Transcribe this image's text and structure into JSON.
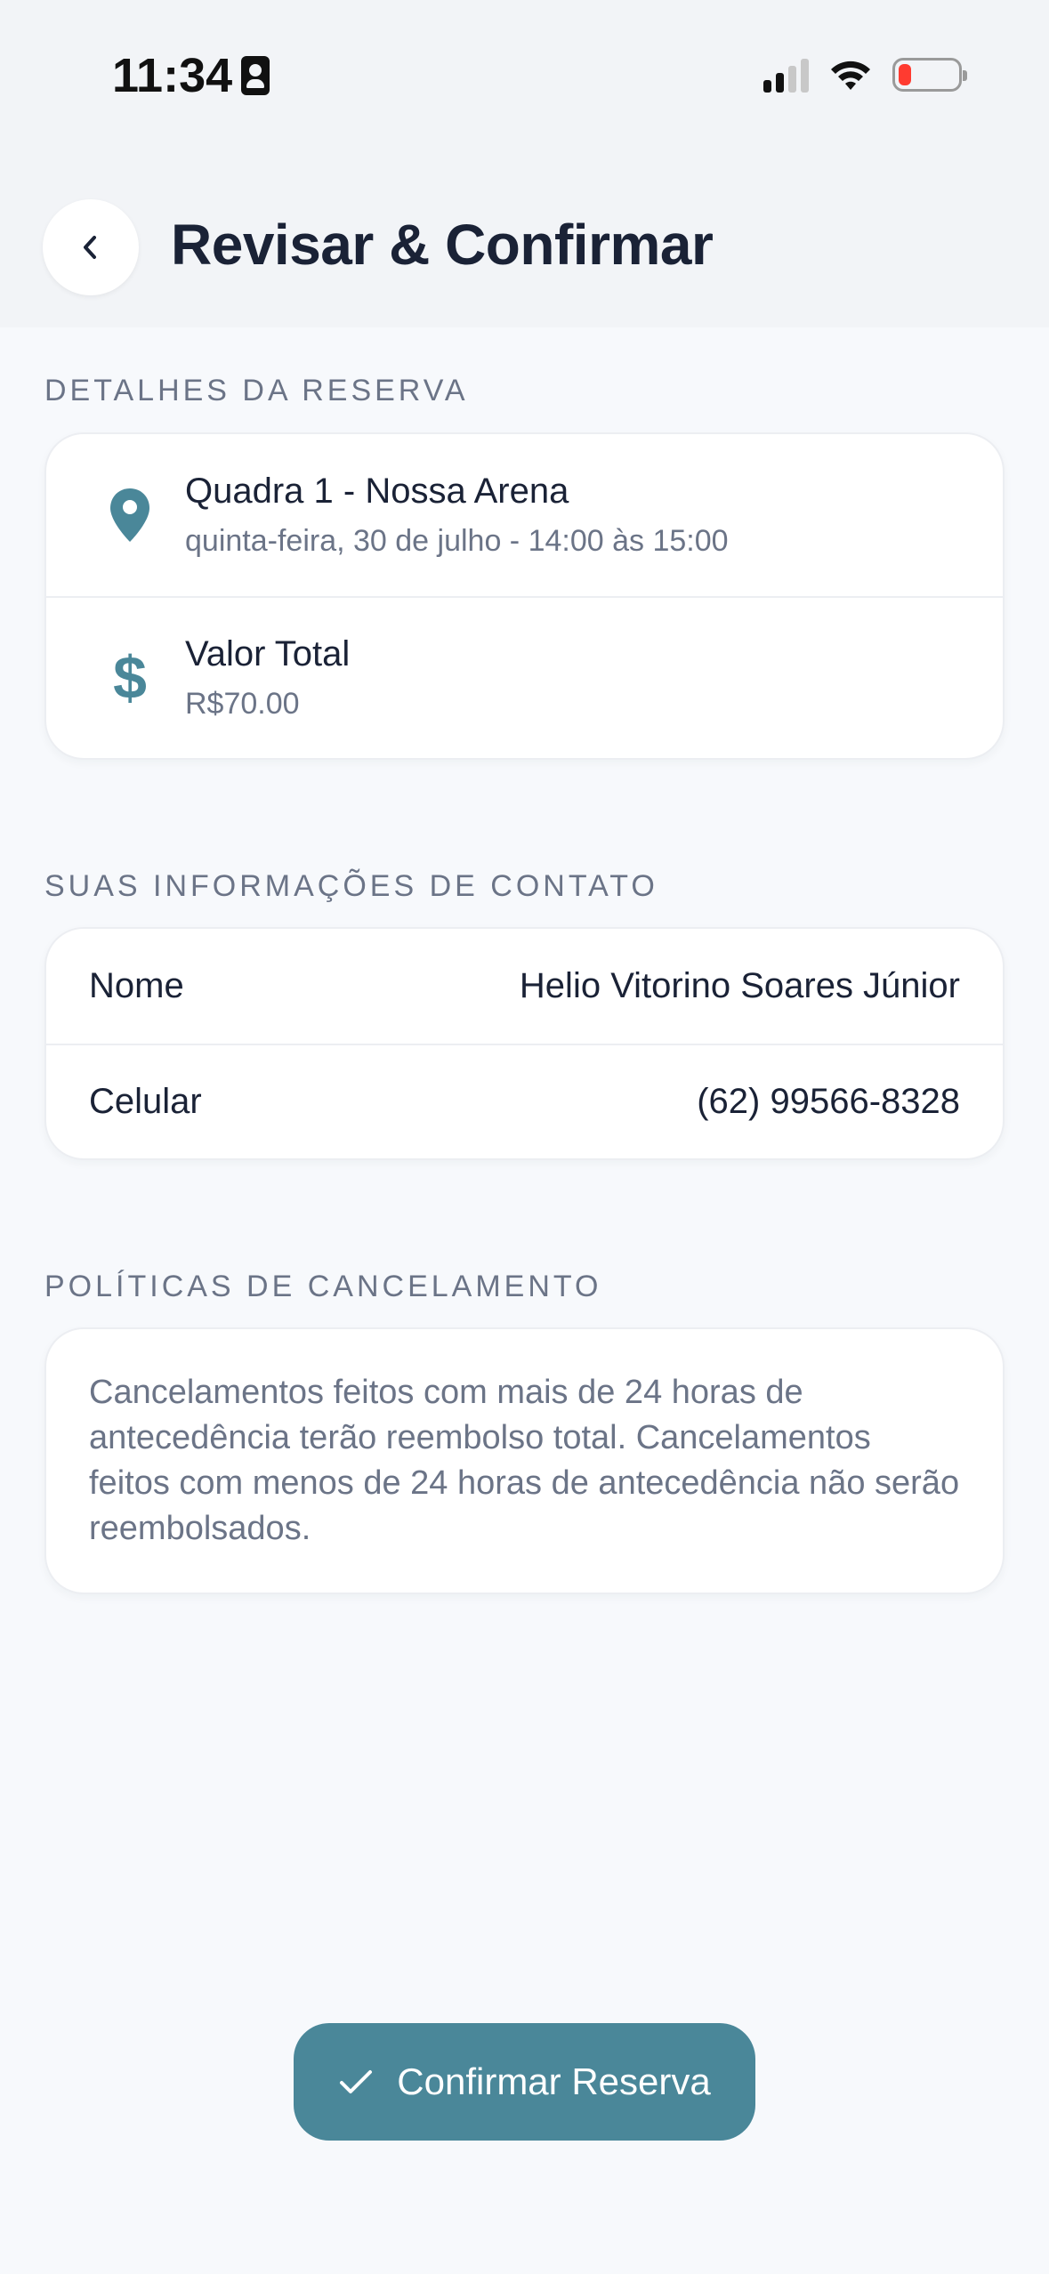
{
  "status_bar": {
    "time": "11:34"
  },
  "header": {
    "title": "Revisar & Confirmar"
  },
  "booking": {
    "section_label": "DETALHES DA RESERVA",
    "location_title": "Quadra 1 - Nossa Arena",
    "location_subtitle": "quinta-feira, 30 de julho - 14:00 às 15:00",
    "price_title": "Valor Total",
    "price_value": "R$70.00"
  },
  "contact": {
    "section_label": "SUAS INFORMAÇÕES DE CONTATO",
    "rows": [
      {
        "label": "Nome",
        "value": "Helio Vitorino Soares Júnior"
      },
      {
        "label": "Celular",
        "value": "(62) 99566-8328"
      }
    ]
  },
  "policy": {
    "section_label": "POLÍTICAS DE CANCELAMENTO",
    "text": "Cancelamentos feitos com mais de 24 horas de antecedência terão reembolso total. Cancelamentos feitos com menos de 24 horas de antecedência não serão reembolsados."
  },
  "footer": {
    "confirm_label": "Confirmar Reserva"
  },
  "colors": {
    "accent": "#4a8799",
    "text": "#1a2236",
    "muted": "#6b7487",
    "battery_low": "#ff3b30"
  },
  "icons": [
    "back-chevron-icon",
    "location-pin-icon",
    "dollar-icon",
    "checkmark-icon",
    "signal-icon",
    "wifi-icon",
    "battery-icon",
    "contact-card-icon"
  ]
}
